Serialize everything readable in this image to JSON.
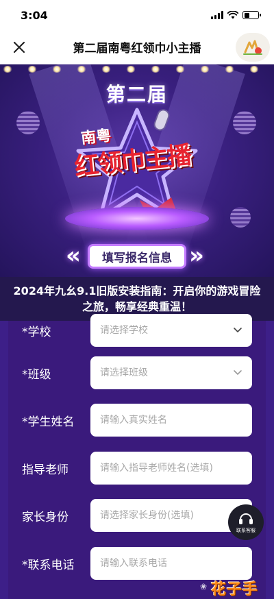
{
  "status_bar": {
    "time": "3:04"
  },
  "nav": {
    "title": "第二届南粤红领巾小主播",
    "close_icon": "close-icon",
    "mini_program_icon": "mini-program-logo-icon"
  },
  "banner": {
    "season": "第二届",
    "logo_line1": "南粤",
    "logo_line2": "红领巾主播",
    "section_button": "填写报名信息"
  },
  "caption": "2024年九幺9.1旧版安装指南：开启你的游戏冒险之旅，畅享经典重温！",
  "form": {
    "fields": [
      {
        "label": "*学校",
        "placeholder": "请选择学校",
        "type": "select"
      },
      {
        "label": "*班级",
        "placeholder": "请选择班级",
        "type": "select"
      },
      {
        "label": "*学生姓名",
        "placeholder": "请输入真实姓名",
        "type": "text"
      },
      {
        "label": "指导老师",
        "placeholder": "请输入指导老师姓名(选填)",
        "type": "text"
      },
      {
        "label": "家长身份",
        "placeholder": "请选择家长身份(选填)",
        "type": "select"
      },
      {
        "label": "*联系电话",
        "placeholder": "请输入联系电话",
        "type": "text"
      }
    ]
  },
  "customer_service": {
    "label": "联系客服",
    "icon": "headset-icon"
  },
  "watermark": "花子手游",
  "colors": {
    "banner_bg": "#3a2080",
    "form_bg": "#3d1f88",
    "logo_red": "#e8232f",
    "neon": "#c37bff"
  }
}
